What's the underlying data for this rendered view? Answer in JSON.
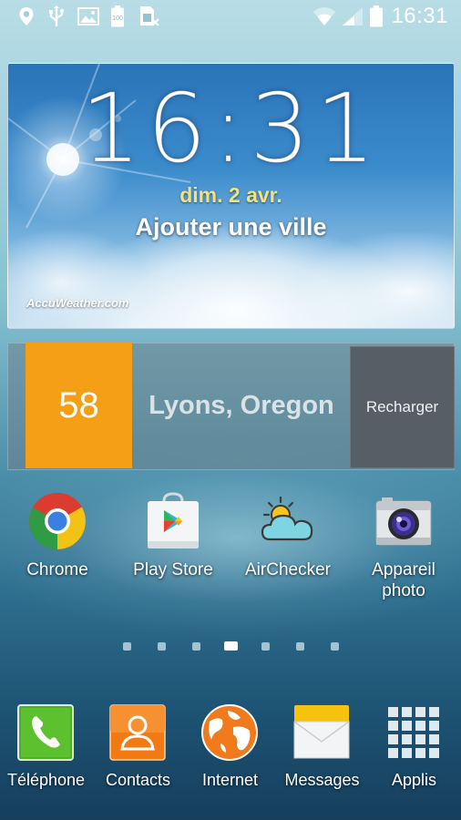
{
  "status_bar": {
    "time": "16:31",
    "left_icons": [
      "location-pin-icon",
      "usb-icon",
      "gallery-icon",
      "battery-100-icon",
      "sim-blocked-icon"
    ],
    "right_icons": [
      "wifi-icon",
      "signal-icon",
      "battery-icon"
    ]
  },
  "weather_widget": {
    "time": "16:31",
    "date": "dim. 2 avr.",
    "add_city": "Ajouter une ville",
    "brand": "AccuWeather.com"
  },
  "location_widget": {
    "temperature": "58",
    "city": "Lyons, Oregon",
    "reload_label": "Recharger",
    "temp_color": "#f49f16"
  },
  "apps": [
    {
      "label": "Chrome",
      "icon": "chrome-icon"
    },
    {
      "label": "Play Store",
      "icon": "play-store-icon"
    },
    {
      "label": "AirChecker",
      "icon": "weather-sun-cloud-icon"
    },
    {
      "label_line1": "Appareil",
      "label_line2": "photo",
      "icon": "camera-icon"
    }
  ],
  "page_indicator": {
    "count": 7,
    "active_index": 3
  },
  "dock": [
    {
      "label": "Téléphone",
      "icon": "phone-icon"
    },
    {
      "label": "Contacts",
      "icon": "contacts-icon"
    },
    {
      "label": "Internet",
      "icon": "globe-icon"
    },
    {
      "label": "Messages",
      "icon": "envelope-icon"
    },
    {
      "label": "Applis",
      "icon": "app-grid-icon"
    }
  ]
}
